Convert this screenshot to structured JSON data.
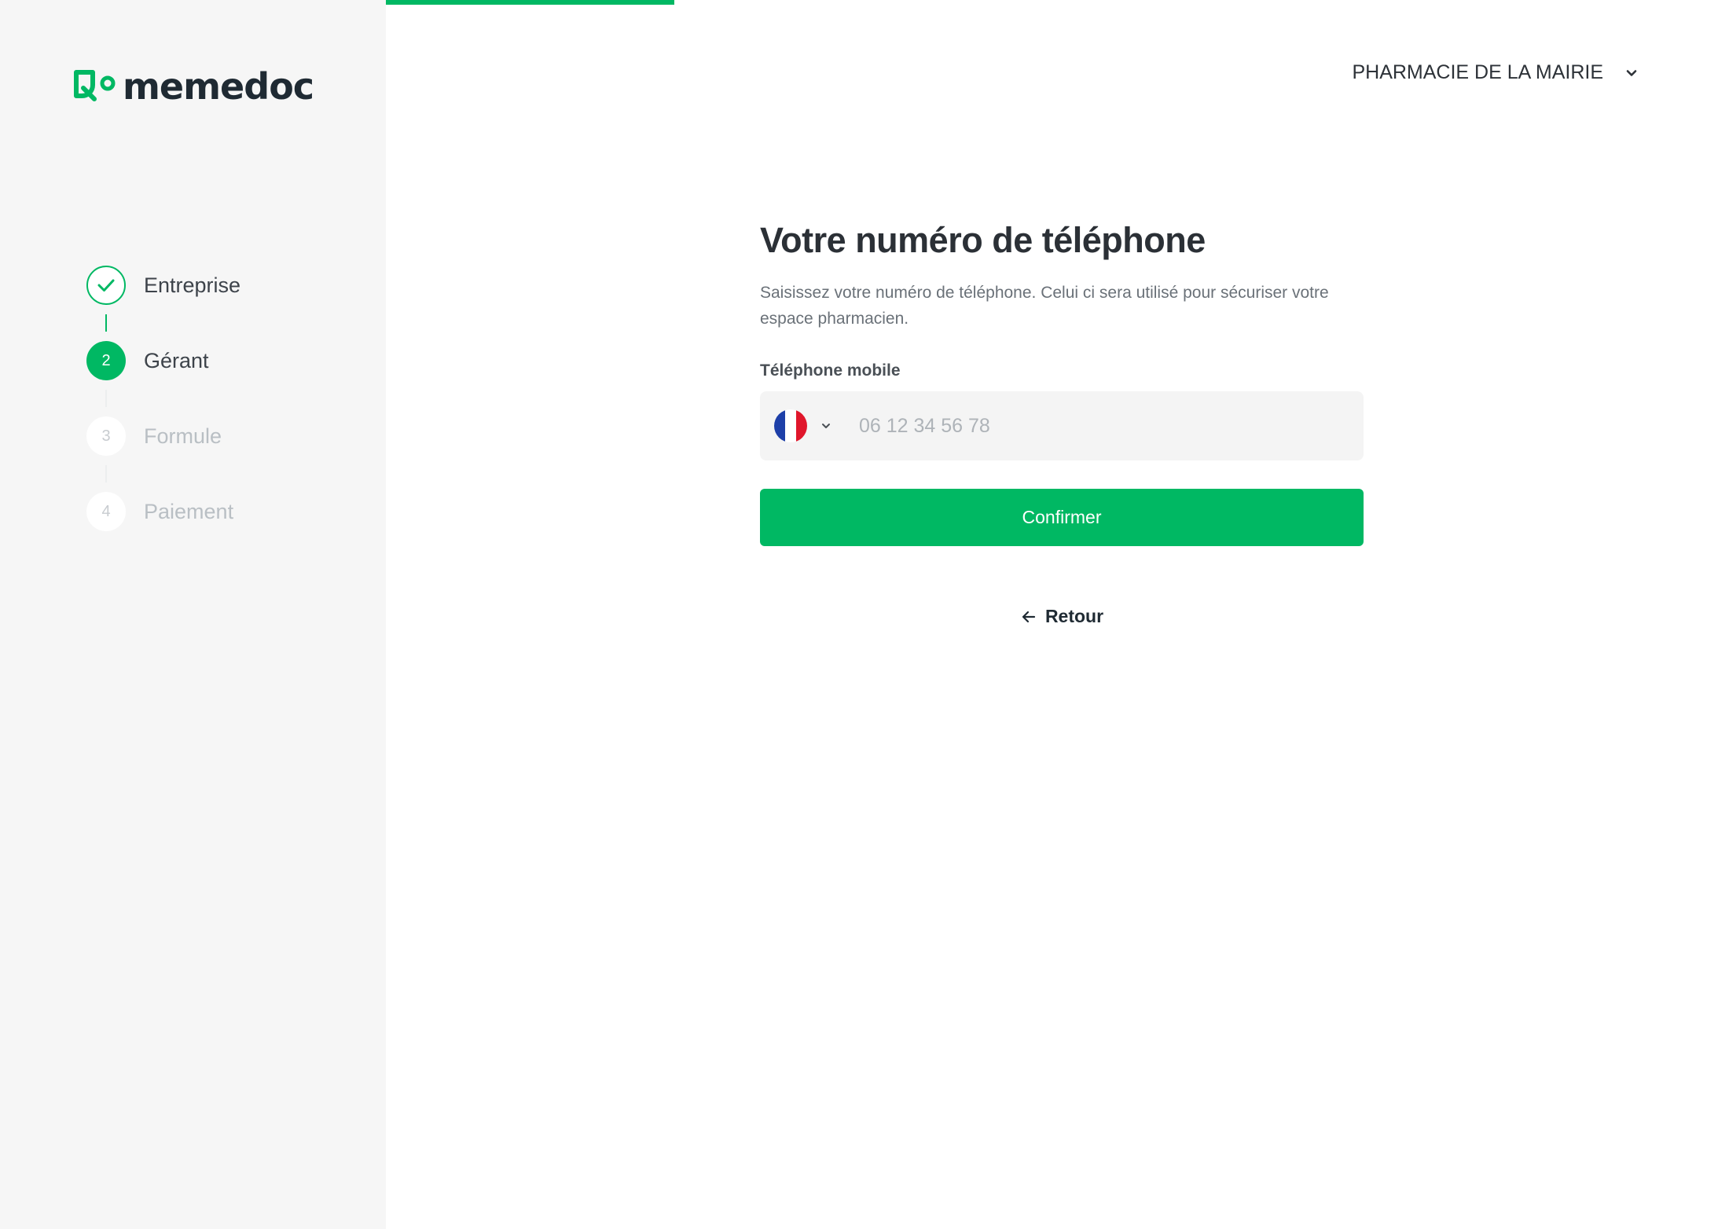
{
  "progress": {
    "fraction": 0.39
  },
  "brand": {
    "name": "memedoc",
    "accent_color": "#00b863",
    "text_color": "#1f2a33"
  },
  "steps": [
    {
      "label": "Entreprise",
      "number": "1",
      "status": "done",
      "icon": "check-icon"
    },
    {
      "label": "Gérant",
      "number": "2",
      "status": "active"
    },
    {
      "label": "Formule",
      "number": "3",
      "status": "todo"
    },
    {
      "label": "Paiement",
      "number": "4",
      "status": "todo"
    }
  ],
  "header": {
    "pharmacy_name": "PHARMACIE DE LA MAIRIE",
    "pharmacy_icon": "chevron-down-icon"
  },
  "form": {
    "title": "Votre numéro de téléphone",
    "description": "Saisissez votre numéro de téléphone. Celui ci sera utilisé pour sécuriser votre espace pharmacien.",
    "phone_label": "Téléphone mobile",
    "country_flag": "france-flag-icon",
    "phone_value": "",
    "phone_placeholder": "06 12 34 56 78",
    "confirm_label": "Confirmer",
    "back_label": "Retour",
    "back_icon": "arrow-left-icon"
  }
}
